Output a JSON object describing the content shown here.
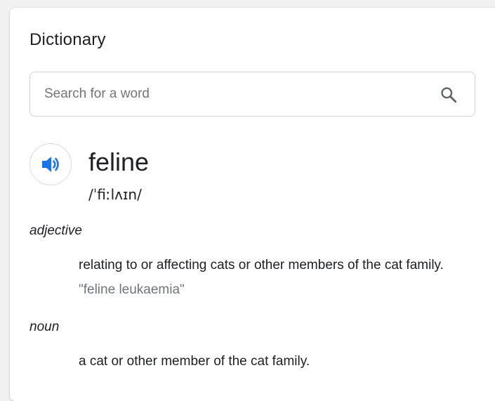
{
  "header": {
    "title": "Dictionary"
  },
  "search": {
    "placeholder": "Search for a word",
    "value": "",
    "icon": "search-icon"
  },
  "entry": {
    "audio_icon": "speaker-icon",
    "accent_color": "#1a73e8",
    "word": "feline",
    "phonetic": "/ˈfiːlʌɪn/",
    "senses": [
      {
        "part_of_speech": "adjective",
        "definition": "relating to or affecting cats or other members of the cat family.",
        "example": "\"feline leukaemia\""
      },
      {
        "part_of_speech": "noun",
        "definition": "a cat or other member of the cat family."
      }
    ]
  }
}
